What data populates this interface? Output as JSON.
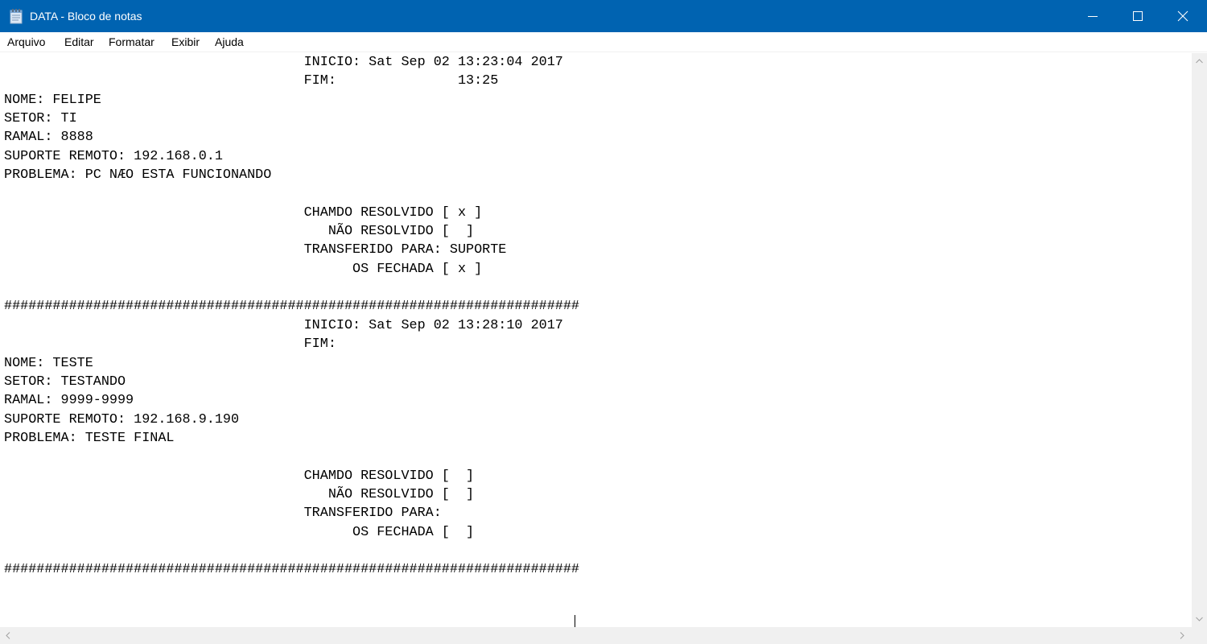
{
  "window": {
    "title": "DATA - Bloco de notas",
    "accent_color": "#0063b1",
    "icons": {
      "app": "notepad-icon",
      "minimize": "minimize-icon",
      "maximize": "maximize-icon",
      "close": "close-icon"
    }
  },
  "menu": {
    "items": [
      "Arquivo",
      "Editar",
      "Formatar",
      "Exibir",
      "Ajuda"
    ]
  },
  "document": {
    "lines": [
      "                                     INICIO: Sat Sep 02 13:23:04 2017",
      "                                     FIM:               13:25",
      "NOME: FELIPE",
      "SETOR: TI",
      "RAMAL: 8888",
      "SUPORTE REMOTO: 192.168.0.1",
      "PROBLEMA: PC NÆO ESTA FUNCIONANDO",
      "",
      "                                     CHAMDO RESOLVIDO [ x ]",
      "                                        NÃO RESOLVIDO [  ]",
      "                                     TRANSFERIDO PARA: SUPORTE",
      "                                           OS FECHADA [ x ]",
      "",
      "#######################################################################",
      "                                     INICIO: Sat Sep 02 13:28:10 2017",
      "                                     FIM:",
      "NOME: TESTE",
      "SETOR: TESTANDO",
      "RAMAL: 9999-9999",
      "SUPORTE REMOTO: 192.168.9.190",
      "PROBLEMA: TESTE FINAL",
      "",
      "                                     CHAMDO RESOLVIDO [  ]",
      "                                        NÃO RESOLVIDO [  ]",
      "                                     TRANSFERIDO PARA:",
      "                                           OS FECHADA [  ]",
      "",
      "#######################################################################"
    ]
  },
  "scrollbars": {
    "icons": {
      "up": "scroll-up-icon",
      "down": "scroll-down-icon",
      "left": "scroll-left-icon",
      "right": "scroll-right-icon"
    }
  }
}
